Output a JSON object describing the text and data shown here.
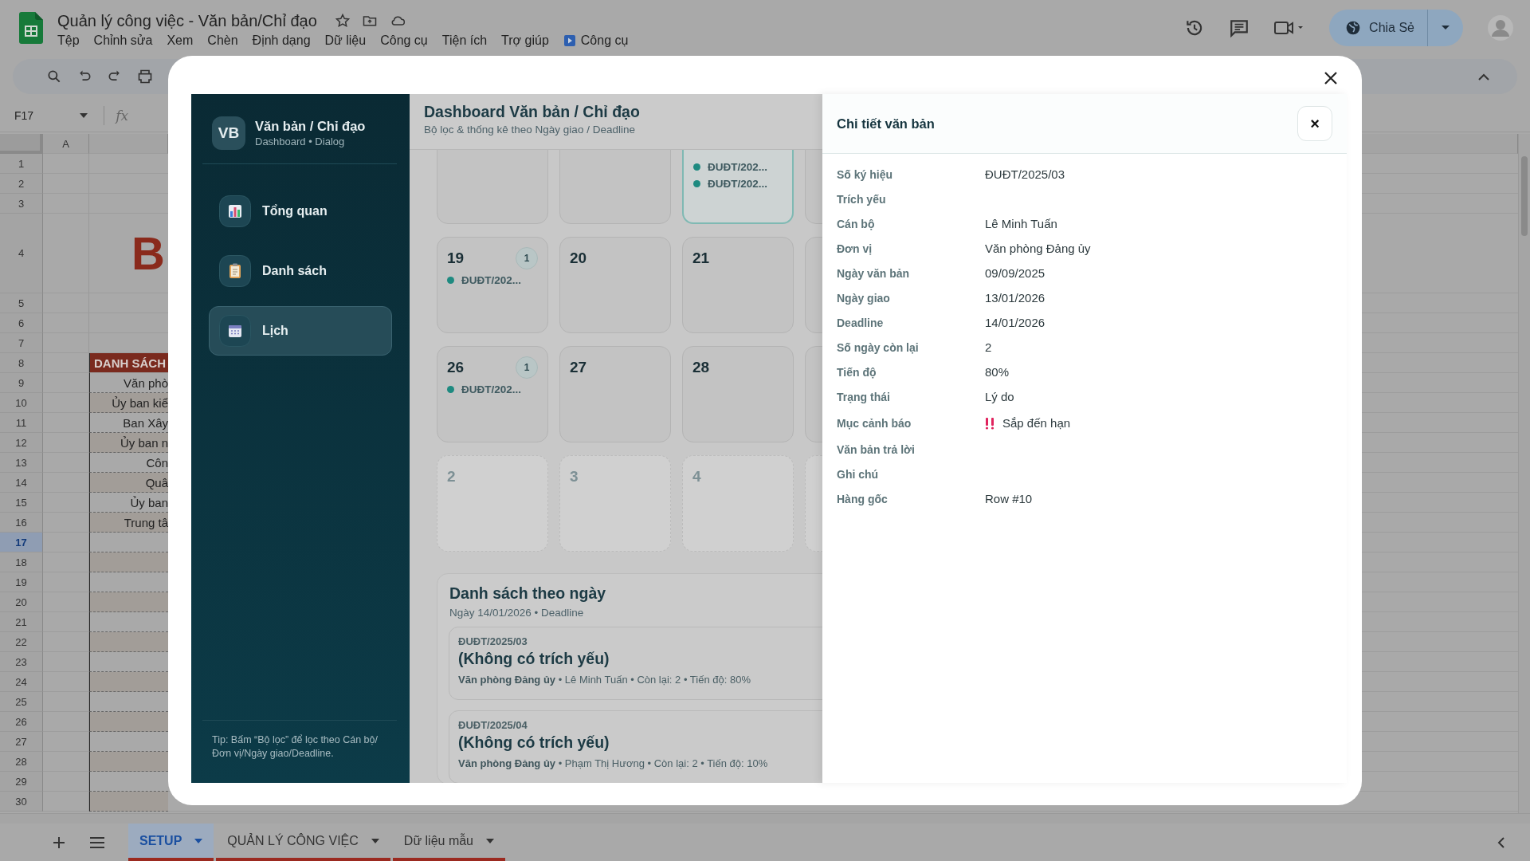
{
  "document_title": "Quản lý công việc - Văn bản/Chỉ đạo",
  "menu": [
    {
      "label": "Tệp",
      "kind": "plain"
    },
    {
      "label": "Chỉnh sửa",
      "kind": "plain"
    },
    {
      "label": "Xem",
      "kind": "plain"
    },
    {
      "label": "Chèn",
      "kind": "plain"
    },
    {
      "label": "Định dạng",
      "kind": "plain"
    },
    {
      "label": "Dữ liệu",
      "kind": "plain"
    },
    {
      "label": "Công cụ",
      "kind": "plain"
    },
    {
      "label": "Tiện ích",
      "kind": "plain"
    },
    {
      "label": "Trợ giúp",
      "kind": "plain"
    },
    {
      "label": "Công cụ",
      "kind": "script"
    }
  ],
  "share_button": "Chia Sẻ",
  "name_box": "F17",
  "formula_label": "fx",
  "sheet": {
    "columns": [
      "A"
    ],
    "rows": [
      {
        "number": "1",
        "selected": false,
        "kind": "blank"
      },
      {
        "number": "2",
        "selected": false,
        "kind": "blank"
      },
      {
        "number": "3",
        "selected": false,
        "kind": "blank"
      },
      {
        "number": "4",
        "selected": false,
        "kind": "title",
        "cell": "B"
      },
      {
        "number": "5",
        "selected": false,
        "kind": "blank"
      },
      {
        "number": "6",
        "selected": false,
        "kind": "blank"
      },
      {
        "number": "7",
        "selected": false,
        "kind": "blank"
      },
      {
        "number": "8",
        "selected": false,
        "kind": "header",
        "cell": "DANH SÁCH"
      },
      {
        "number": "9",
        "selected": false,
        "kind": "item",
        "cell": "Văn phò"
      },
      {
        "number": "10",
        "selected": false,
        "kind": "item",
        "cell": "Ủy ban kiể"
      },
      {
        "number": "11",
        "selected": false,
        "kind": "item",
        "cell": "Ban Xây"
      },
      {
        "number": "12",
        "selected": false,
        "kind": "item",
        "cell": "Ủy ban n"
      },
      {
        "number": "13",
        "selected": false,
        "kind": "item",
        "cell": "Côn"
      },
      {
        "number": "14",
        "selected": false,
        "kind": "item",
        "cell": "Quâ"
      },
      {
        "number": "15",
        "selected": false,
        "kind": "item",
        "cell": "Ủy ban"
      },
      {
        "number": "16",
        "selected": false,
        "kind": "item",
        "cell": "Trung tâ"
      },
      {
        "number": "17",
        "selected": true,
        "kind": "item"
      },
      {
        "number": "18",
        "selected": false,
        "kind": "item"
      },
      {
        "number": "19",
        "selected": false,
        "kind": "item"
      },
      {
        "number": "20",
        "selected": false,
        "kind": "item"
      },
      {
        "number": "21",
        "selected": false,
        "kind": "item"
      },
      {
        "number": "22",
        "selected": false,
        "kind": "item"
      },
      {
        "number": "23",
        "selected": false,
        "kind": "item"
      },
      {
        "number": "24",
        "selected": false,
        "kind": "item"
      },
      {
        "number": "25",
        "selected": false,
        "kind": "item"
      },
      {
        "number": "26",
        "selected": false,
        "kind": "item"
      },
      {
        "number": "27",
        "selected": false,
        "kind": "item"
      },
      {
        "number": "28",
        "selected": false,
        "kind": "item"
      },
      {
        "number": "29",
        "selected": false,
        "kind": "item"
      },
      {
        "number": "30",
        "selected": false,
        "kind": "item"
      }
    ]
  },
  "sheet_tabs": [
    {
      "label": "SETUP",
      "selected": true
    },
    {
      "label": "QUẢN LÝ CÔNG VIỆC",
      "selected": false
    },
    {
      "label": "Dữ liệu mẫu",
      "selected": false
    }
  ],
  "dialog": {
    "sidebar": {
      "logo": "VB",
      "title": "Văn bản / Chỉ đạo",
      "subtitle": "Dashboard • Dialog",
      "nav": [
        {
          "label": "Tổng quan",
          "selected": false
        },
        {
          "label": "Danh sách",
          "selected": false
        },
        {
          "label": "Lịch",
          "selected": true
        }
      ],
      "tip": "Tip: Bấm “Bộ lọc” để lọc theo Cán bộ/Đơn vị/Ngày giao/Deadline."
    },
    "header": {
      "title": "Dashboard Văn bản / Chỉ đạo",
      "subtitle": "Bộ lọc & thống kê theo Ngày giao / Deadline"
    },
    "calendar": {
      "weeks": [
        {
          "cells": [
            {
              "selected": false,
              "outside_month": false
            },
            {
              "selected": false,
              "outside_month": false
            },
            {
              "selected": true,
              "outside_month": false,
              "entries": [
                "ĐUĐT/202...",
                "ĐUĐT/202..."
              ]
            },
            {
              "selected": false,
              "outside_month": false
            }
          ]
        },
        {
          "cells": [
            {
              "day": "19",
              "count": "1",
              "selected": false,
              "outside_month": false,
              "entries": [
                "ĐUĐT/202..."
              ]
            },
            {
              "day": "20",
              "selected": false,
              "outside_month": false
            },
            {
              "day": "21",
              "selected": false,
              "outside_month": false
            },
            {
              "selected": false,
              "outside_month": false
            }
          ]
        },
        {
          "cells": [
            {
              "day": "26",
              "count": "1",
              "selected": false,
              "outside_month": false,
              "entries": [
                "ĐUĐT/202..."
              ]
            },
            {
              "day": "27",
              "selected": false,
              "outside_month": false
            },
            {
              "day": "28",
              "selected": false,
              "outside_month": false
            },
            {
              "selected": false,
              "outside_month": false
            }
          ]
        },
        {
          "cells": [
            {
              "day": "2",
              "selected": false,
              "outside_month": true
            },
            {
              "day": "3",
              "selected": false,
              "outside_month": true
            },
            {
              "day": "4",
              "selected": false,
              "outside_month": true
            },
            {
              "selected": false,
              "outside_month": true
            }
          ]
        }
      ]
    },
    "day_list": {
      "title": "Danh sách theo ngày",
      "subtitle": "Ngày 14/01/2026 • Deadline",
      "items": [
        {
          "code": "ĐUĐT/2025/03",
          "title": "(Không có trích yếu)",
          "meta": "**Văn phòng Đảng ủy** • Lê Minh Tuấn • Còn lại: 2 • Tiến độ: 80%"
        },
        {
          "code": "ĐUĐT/2025/04",
          "title": "(Không có trích yếu)",
          "meta": "**Văn phòng Đảng ủy** • Phạm Thị Hương • Còn lại: 2 • Tiến độ: 10%"
        }
      ]
    },
    "detail": {
      "title": "Chi tiết văn bản",
      "close": "×",
      "fields": [
        {
          "label": "Số ký hiệu",
          "value": "ĐUĐT/2025/03",
          "kind": "text"
        },
        {
          "label": "Trích yếu",
          "kind": "text"
        },
        {
          "label": "Cán bộ",
          "value": "Lê Minh Tuấn",
          "kind": "text"
        },
        {
          "label": "Đơn vị",
          "value": "Văn phòng Đảng ủy",
          "kind": "text"
        },
        {
          "label": "Ngày văn bản",
          "value": "09/09/2025",
          "kind": "text"
        },
        {
          "label": "Ngày giao",
          "value": "13/01/2026",
          "kind": "text"
        },
        {
          "label": "Deadline",
          "value": "14/01/2026",
          "kind": "text"
        },
        {
          "label": "Số ngày còn lại",
          "value": "2",
          "kind": "text"
        },
        {
          "label": "Tiến độ",
          "value": "80%",
          "kind": "text"
        },
        {
          "label": "Trạng thái",
          "value": "Lý do",
          "kind": "text"
        },
        {
          "label": "Mục cảnh báo",
          "value": "Sắp đến hạn",
          "kind": "alert"
        },
        {
          "label": "Văn bản trả lời",
          "kind": "text"
        },
        {
          "label": "Ghi chú",
          "kind": "text"
        },
        {
          "label": "Hàng gốc",
          "value": "Row #10",
          "kind": "text"
        }
      ]
    }
  }
}
